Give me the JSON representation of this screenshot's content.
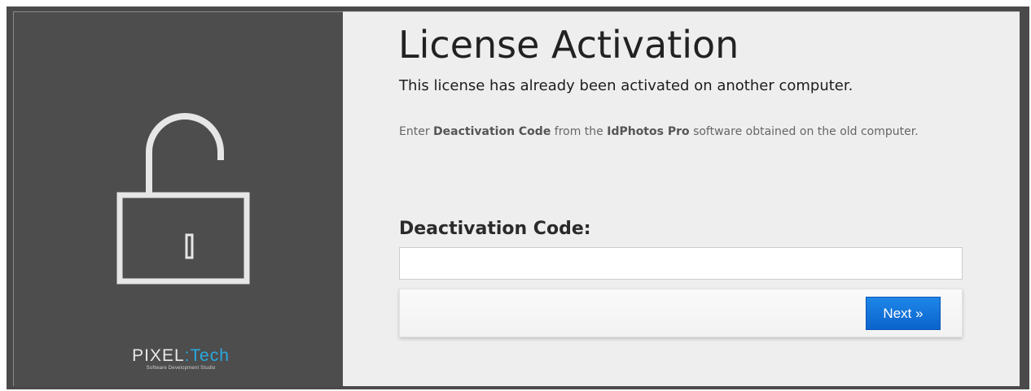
{
  "sidebar": {
    "lock_icon": "unlocked-padlock-icon",
    "brand": {
      "name_part1": "PIXEL",
      "separator": ":",
      "name_part2": "Tech",
      "tagline": "Software Development Studio"
    }
  },
  "main": {
    "title": "License Activation",
    "subtitle": "This license has already been activated on another computer.",
    "instructions": {
      "pre": "Enter ",
      "code_name": "Deactivation Code",
      "mid": " from the ",
      "product_name": "IdPhotos Pro",
      "post": " software obtained on the old computer."
    },
    "code_field": {
      "label": "Deactivation Code:",
      "value": "",
      "placeholder": ""
    },
    "next_button": {
      "label": "Next »"
    }
  },
  "colors": {
    "sidebar_background": "#4d4d4d",
    "content_background": "#eeeeee",
    "accent_blue": "#1e86e8",
    "brand_blue": "#29a8e0"
  }
}
